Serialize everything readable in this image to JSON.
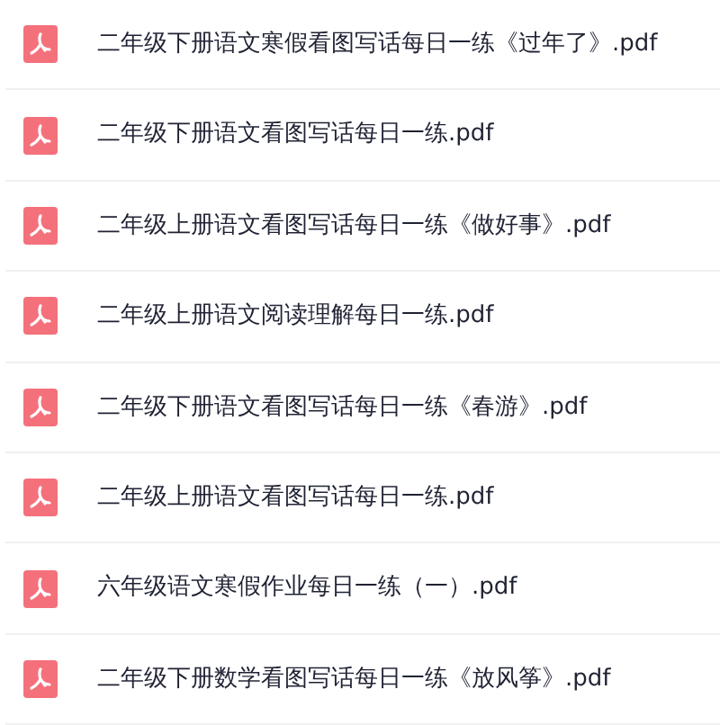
{
  "files": [
    {
      "name": "二年级下册语文寒假看图写话每日一练《过年了》.pdf"
    },
    {
      "name": "二年级下册语文看图写话每日一练.pdf"
    },
    {
      "name": "二年级上册语文看图写话每日一练《做好事》.pdf"
    },
    {
      "name": "二年级上册语文阅读理解每日一练.pdf"
    },
    {
      "name": "二年级下册语文看图写话每日一练《春游》.pdf"
    },
    {
      "name": "二年级上册语文看图写话每日一练.pdf"
    },
    {
      "name": "六年级语文寒假作业每日一练（一）.pdf"
    },
    {
      "name": "二年级下册数学看图写话每日一练《放风筝》.pdf"
    }
  ]
}
